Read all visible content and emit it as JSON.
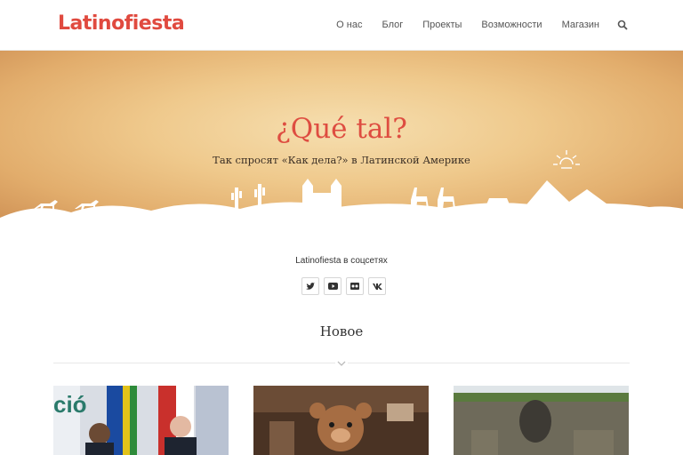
{
  "header": {
    "logo": "Latinofiesta",
    "nav": [
      "О нас",
      "Блог",
      "Проекты",
      "Возможности",
      "Магазин"
    ]
  },
  "hero": {
    "title": "¿Qué tal?",
    "subtitle": "Так спросят «Как дела?» в Латинской Америке"
  },
  "social": {
    "label": "Latinofiesta в соцсетях",
    "icons": [
      "twitter-icon",
      "youtube-icon",
      "flickr-icon",
      "vk-icon"
    ]
  },
  "section": {
    "title": "Новое"
  },
  "colors": {
    "brand": "#e04a3f",
    "hero_bg": "#efc98c"
  }
}
